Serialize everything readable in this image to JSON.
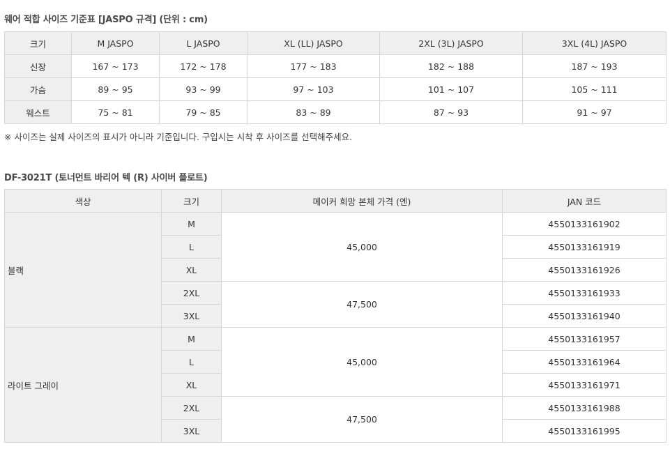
{
  "size_chart": {
    "title": "웨어 적합 사이즈 기준표 [JASPO 규격] (단위 : cm)",
    "header": [
      "크기",
      "M JASPO",
      "L JASPO",
      "XL (LL) JASPO",
      "2XL (3L) JASPO",
      "3XL (4L) JASPO"
    ],
    "rows": [
      {
        "label": "신장",
        "values": [
          "167 ~ 173",
          "172 ~ 178",
          "177 ~ 183",
          "182 ~ 188",
          "187 ~ 193"
        ]
      },
      {
        "label": "가슴",
        "values": [
          "89 ~ 95",
          "93 ~ 99",
          "97 ~ 103",
          "101 ~ 107",
          "105 ~ 111"
        ]
      },
      {
        "label": "웨스트",
        "values": [
          "75 ~ 81",
          "79 ~ 85",
          "83 ~ 89",
          "87 ~ 93",
          "91 ~ 97"
        ]
      }
    ],
    "note": "※ 사이즈는 실제 사이즈의 표시가 아니라 기준입니다. 구입시는 시착 후 사이즈를 선택해주세요."
  },
  "product": {
    "title": "DF-3021T (토너먼트 바리어 텍 (R) 사이버 플로트)",
    "header": [
      "색상",
      "크기",
      "메이커 희망 본체 가격 (엔)",
      "JAN 코드"
    ],
    "colors": [
      {
        "name": "블랙",
        "price_groups": [
          {
            "price": "45,000",
            "items": [
              {
                "size": "M",
                "jan": "4550133161902"
              },
              {
                "size": "L",
                "jan": "4550133161919"
              },
              {
                "size": "XL",
                "jan": "4550133161926"
              }
            ]
          },
          {
            "price": "47,500",
            "items": [
              {
                "size": "2XL",
                "jan": "4550133161933"
              },
              {
                "size": "3XL",
                "jan": "4550133161940"
              }
            ]
          }
        ]
      },
      {
        "name": "라이트 그레이",
        "price_groups": [
          {
            "price": "45,000",
            "items": [
              {
                "size": "M",
                "jan": "4550133161957"
              },
              {
                "size": "L",
                "jan": "4550133161964"
              },
              {
                "size": "XL",
                "jan": "4550133161971"
              }
            ]
          },
          {
            "price": "47,500",
            "items": [
              {
                "size": "2XL",
                "jan": "4550133161988"
              },
              {
                "size": "3XL",
                "jan": "4550133161995"
              }
            ]
          }
        ]
      }
    ]
  }
}
